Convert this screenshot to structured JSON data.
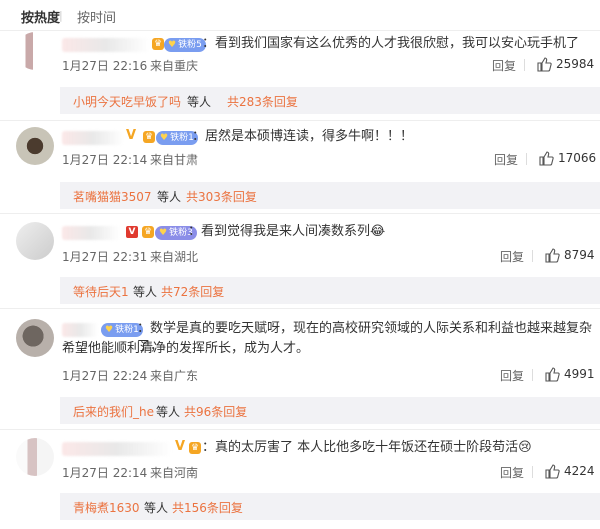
{
  "tabs": {
    "active": "按热度",
    "inactive": "按时间"
  },
  "colors": {
    "accent": "#eb7340",
    "badge_blue": "#7a9df0",
    "vip_gold": "#f5a623"
  },
  "comments": [
    {
      "badge": "铁粉5",
      "text": "：看到我们国家有这么优秀的人才我很欣慰，我可以安心玩手机了",
      "time": "1月27日 22:16",
      "location": "来自重庆",
      "reply_label": "回复",
      "likes": "25984",
      "sub_user": "小明今天吃早饭了吗",
      "sub_etc": "等人",
      "sub_count": "共283条回复"
    },
    {
      "badge": "铁粉1",
      "text": "：居然是本硕博连读，得多牛啊！！！",
      "time": "1月27日 22:14",
      "location": "来自甘肃",
      "reply_label": "回复",
      "likes": "17066",
      "sub_user": "茗嘴猫猫3507",
      "sub_etc": "等人",
      "sub_count": "共303条回复"
    },
    {
      "badge": "铁粉3",
      "text": "：看到觉得我是来人间凑数系列",
      "time": "1月27日 22:31",
      "location": "来自湖北",
      "reply_label": "回复",
      "likes": "8794",
      "sub_user": "等待后天1",
      "sub_etc": "等人",
      "sub_count": "共72条回复"
    },
    {
      "badge": "铁粉1",
      "text_line1": "：数学是真的要吃天赋呀，现在的高校研究领域的人际关系和利益也越来越复杂了，",
      "text_line2": "希望他能顺利清净的发挥所长，成为人才。",
      "time": "1月27日 22:24",
      "location": "来自广东",
      "reply_label": "回复",
      "likes": "4991",
      "sub_user": "后来的我们_he",
      "sub_etc": "等人",
      "sub_count": "共96条回复"
    },
    {
      "text": "：真的太厉害了 本人比他多吃十年饭还在硕士阶段苟活",
      "time": "1月27日 22:14",
      "location": "来自河南",
      "reply_label": "回复",
      "likes": "4224",
      "sub_user": "青梅煮1630",
      "sub_etc": "等人",
      "sub_count": "共156条回复"
    }
  ]
}
